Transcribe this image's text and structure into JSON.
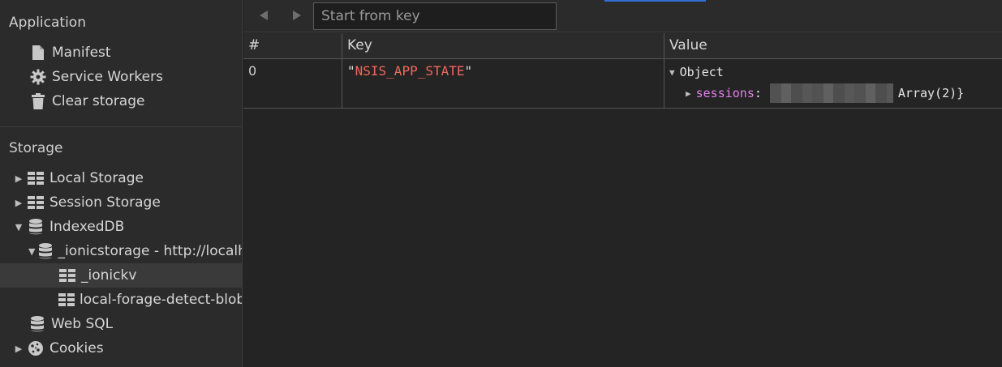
{
  "sidebar": {
    "application_header": "Application",
    "application_items": [
      {
        "label": "Manifest",
        "icon": "file-icon"
      },
      {
        "label": "Service Workers",
        "icon": "gear-icon"
      },
      {
        "label": "Clear storage",
        "icon": "trash-icon"
      }
    ],
    "storage_header": "Storage",
    "storage_items": [
      {
        "label": "Local Storage",
        "icon": "grid-icon",
        "expanded": false
      },
      {
        "label": "Session Storage",
        "icon": "grid-icon",
        "expanded": false
      },
      {
        "label": "IndexedDB",
        "icon": "database-icon",
        "expanded": true
      },
      {
        "label": "_ionicstorage - http://localhost",
        "icon": "database-icon",
        "expanded": true
      },
      {
        "label": "_ionickv",
        "icon": "grid-icon",
        "selected": true
      },
      {
        "label": "local-forage-detect-blob-support",
        "icon": "grid-icon"
      },
      {
        "label": "Web SQL",
        "icon": "database-icon"
      },
      {
        "label": "Cookies",
        "icon": "cookie-icon",
        "expanded": false
      }
    ]
  },
  "toolbar": {
    "back_icon": "triangle-left-icon",
    "forward_icon": "triangle-right-icon",
    "search_placeholder": "Start from key"
  },
  "table": {
    "columns": [
      "#",
      "Key",
      "Value"
    ],
    "rows": [
      {
        "index": "0",
        "key_quote_open": "\"",
        "key": "NSIS_APP_STATE",
        "key_quote_close": "\"",
        "value_type": "Object",
        "value_prop": "sessions",
        "value_colon": ":",
        "value_tail": "Array(2)}"
      }
    ]
  },
  "colors": {
    "string": "#f2685c",
    "property": "#e082e8",
    "accent": "#2f6fd6"
  }
}
